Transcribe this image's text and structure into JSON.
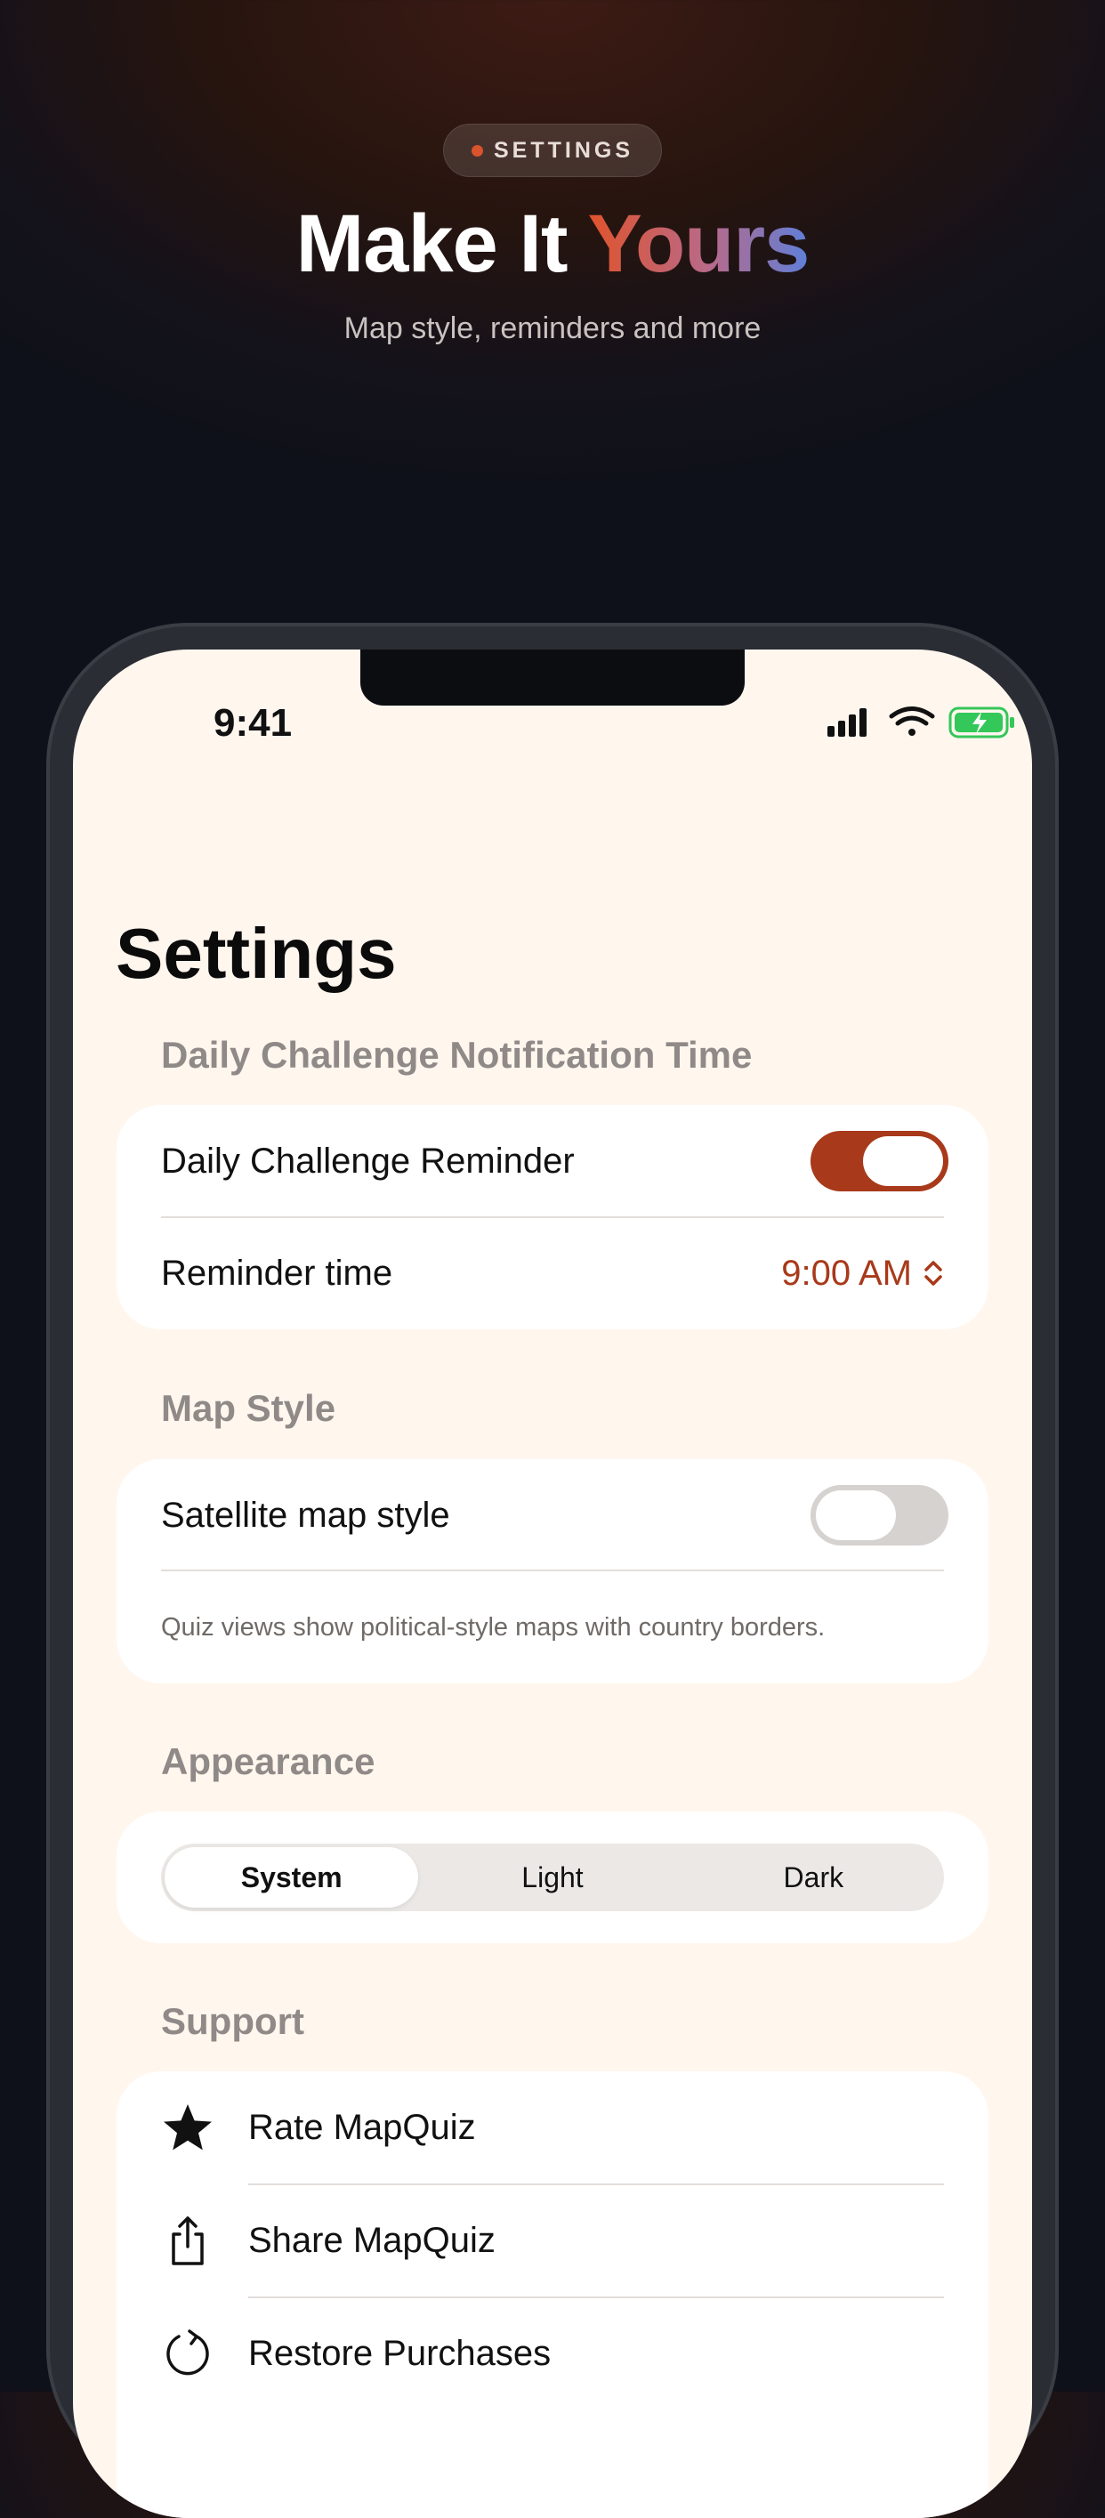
{
  "hero": {
    "badge": "SETTINGS",
    "title_plain": "Make It ",
    "title_accent": "Yours",
    "subtitle": "Map style, reminders and more"
  },
  "status_bar": {
    "time": "9:41"
  },
  "page": {
    "title": "Settings"
  },
  "sections": {
    "notifications": {
      "header": "Daily Challenge Notification Time",
      "reminder_label": "Daily Challenge Reminder",
      "reminder_enabled": true,
      "time_label": "Reminder time",
      "time_value": "9:00 AM"
    },
    "map_style": {
      "header": "Map Style",
      "satellite_label": "Satellite map style",
      "satellite_enabled": false,
      "footnote": "Quiz views show political-style maps with country borders."
    },
    "appearance": {
      "header": "Appearance",
      "options": [
        "System",
        "Light",
        "Dark"
      ],
      "selected": "System"
    },
    "support": {
      "header": "Support",
      "items": [
        {
          "label": "Rate MapQuiz",
          "icon": "star-icon"
        },
        {
          "label": "Share MapQuiz",
          "icon": "share-icon"
        },
        {
          "label": "Restore Purchases",
          "icon": "restore-icon"
        }
      ]
    }
  },
  "colors": {
    "accent": "#a8391a",
    "screen_background": "#fff6ee",
    "toggle_off": "#d5d2d0",
    "battery_green": "#34c759"
  }
}
